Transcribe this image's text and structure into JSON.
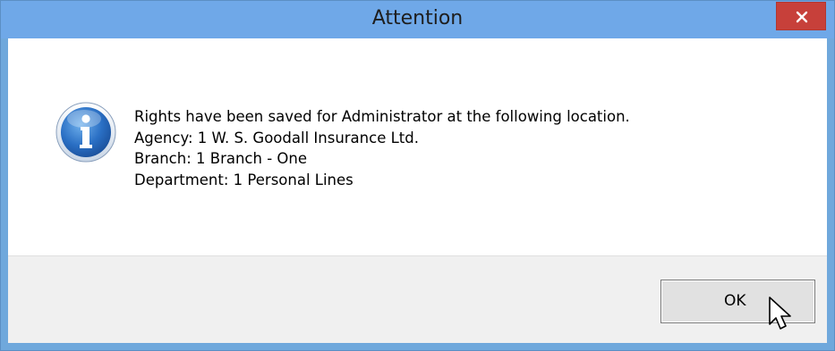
{
  "window": {
    "title": "Attention",
    "close_icon": "close-icon"
  },
  "message": {
    "icon": "info-icon",
    "lines": [
      "Rights have been saved for Administrator at the following location.",
      "Agency: 1 W. S. Goodall Insurance Ltd.",
      "Branch: 1 Branch - One",
      "Department: 1 Personal Lines"
    ]
  },
  "buttons": {
    "ok_label": "OK"
  },
  "colors": {
    "titlebar": "#6fa8e8",
    "close_button": "#c7403a",
    "footer": "#f0f0f0"
  }
}
